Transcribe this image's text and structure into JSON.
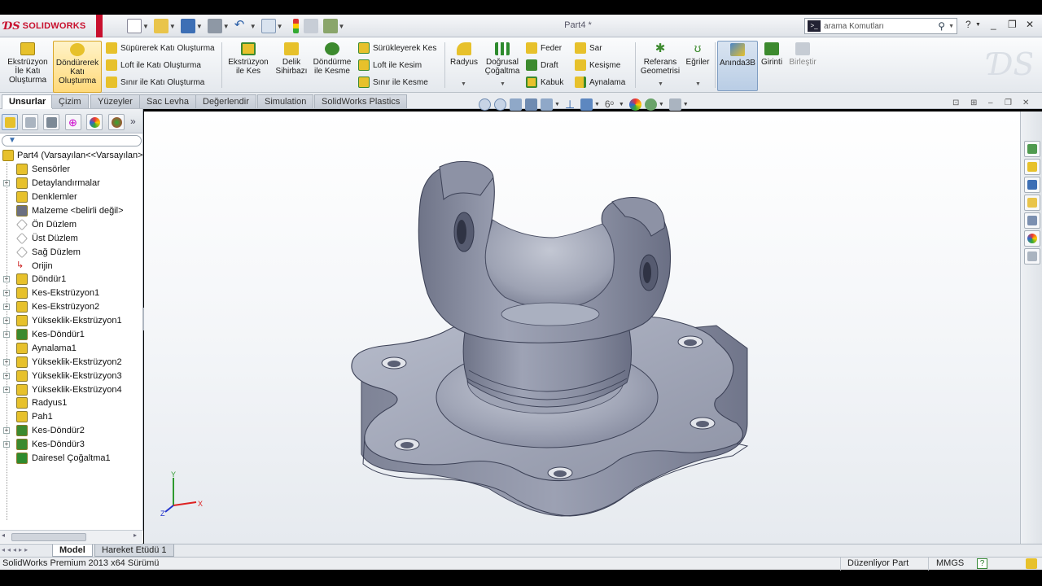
{
  "app": {
    "brand": "SOLIDWORKS",
    "document_title": "Part4 *"
  },
  "search": {
    "placeholder": "arama Komutları"
  },
  "command_manager": {
    "features": {
      "extrude_boss": "Ekstrüzyon İle Katı Oluşturma",
      "revolve_boss": "Döndürerek Katı Oluşturma",
      "sweep_boss": "Süpürerek Katı Oluşturma",
      "loft_boss": "Loft ile Katı Oluşturma",
      "boundary_boss": "Sınır ile Katı Oluşturma",
      "extrude_cut": "Ekstrüzyon ile Kes",
      "hole_wizard": "Delik Sihirbazı",
      "revolve_cut": "Döndürme ile Kesme",
      "swept_cut": "Sürükleyerek Kes",
      "loft_cut": "Loft ile Kesim",
      "boundary_cut": "Sınır ile Kesme",
      "fillet": "Radyus",
      "linear_pattern": "Doğrusal Çoğaltma",
      "rib": "Feder",
      "draft": "Draft",
      "shell": "Kabuk",
      "wrap": "Sar",
      "intersect": "Kesişme",
      "mirror": "Aynalama",
      "reference_geometry": "Referans Geometrisi",
      "curves": "Eğriler",
      "instant3d": "Anında3B",
      "indent": "Girinti",
      "combine": "Birleştir"
    }
  },
  "tabs": [
    {
      "label": "Unsurlar",
      "active": true
    },
    {
      "label": "Çizim"
    },
    {
      "label": "Yüzeyler"
    },
    {
      "label": "Sac Levha"
    },
    {
      "label": "Değerlendir"
    },
    {
      "label": "Simulation"
    },
    {
      "label": "SolidWorks Plastics"
    }
  ],
  "feature_tree": {
    "root": "Part4  (Varsayılan<<Varsayılan>",
    "items": [
      {
        "label": "Sensörler",
        "icon": "sensor-icon",
        "expandable": false
      },
      {
        "label": "Detaylandırmalar",
        "icon": "annotations-icon",
        "expandable": true
      },
      {
        "label": "Denklemler",
        "icon": "equations-icon",
        "expandable": false
      },
      {
        "label": "Malzeme <belirli değil>",
        "icon": "material-icon",
        "expandable": false
      },
      {
        "label": "Ön Düzlem",
        "icon": "plane-icon",
        "expandable": false
      },
      {
        "label": "Üst Düzlem",
        "icon": "plane-icon",
        "expandable": false
      },
      {
        "label": "Sağ Düzlem",
        "icon": "plane-icon",
        "expandable": false
      },
      {
        "label": "Orijin",
        "icon": "origin-icon",
        "expandable": false
      },
      {
        "label": "Döndür1",
        "icon": "revolve-icon",
        "expandable": true
      },
      {
        "label": "Kes-Ekstrüzyon1",
        "icon": "extrude-cut-icon",
        "expandable": true
      },
      {
        "label": "Kes-Ekstrüzyon2",
        "icon": "extrude-cut-icon",
        "expandable": true
      },
      {
        "label": "Yükseklik-Ekstrüzyon1",
        "icon": "extrude-boss-icon",
        "expandable": true
      },
      {
        "label": "Kes-Döndür1",
        "icon": "revolve-cut-icon",
        "expandable": true
      },
      {
        "label": "Aynalama1",
        "icon": "mirror-icon",
        "expandable": false
      },
      {
        "label": "Yükseklik-Ekstrüzyon2",
        "icon": "extrude-boss-icon",
        "expandable": true
      },
      {
        "label": "Yükseklik-Ekstrüzyon3",
        "icon": "extrude-boss-icon",
        "expandable": true
      },
      {
        "label": "Yükseklik-Ekstrüzyon4",
        "icon": "extrude-boss-icon",
        "expandable": true
      },
      {
        "label": "Radyus1",
        "icon": "fillet-icon",
        "expandable": false
      },
      {
        "label": "Pah1",
        "icon": "chamfer-icon",
        "expandable": false
      },
      {
        "label": "Kes-Döndür2",
        "icon": "revolve-cut-icon",
        "expandable": true
      },
      {
        "label": "Kes-Döndür3",
        "icon": "revolve-cut-icon",
        "expandable": true
      },
      {
        "label": "Dairesel Çoğaltma1",
        "icon": "circular-pattern-icon",
        "expandable": false
      }
    ]
  },
  "bottom_tabs": [
    {
      "label": "Model",
      "active": true
    },
    {
      "label": "Hareket Etüdü 1"
    }
  ],
  "status": {
    "version": "SolidWorks Premium 2013 x64 Sürümü",
    "mode": "Düzenliyor Part",
    "units": "MMGS",
    "help": "?"
  },
  "triad": {
    "x": "X",
    "y": "Y",
    "z": "Z"
  },
  "colors": {
    "brand_red": "#c8102e",
    "model_gray": "#9a9fb0",
    "tab_active": "#ffffff"
  }
}
